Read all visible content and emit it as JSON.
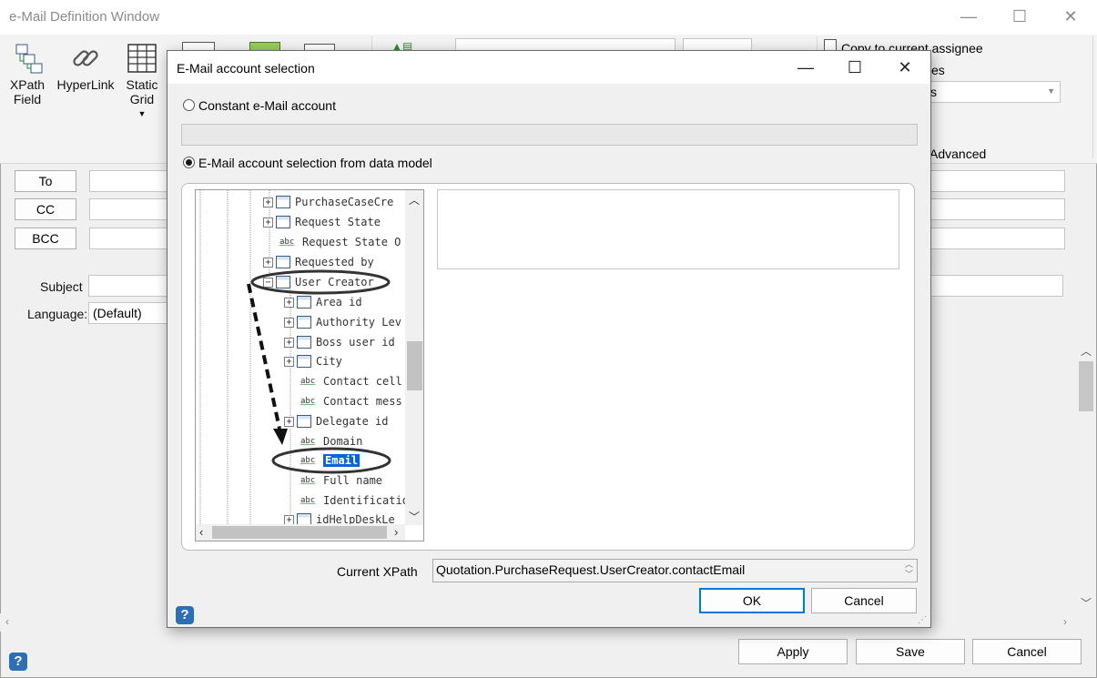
{
  "window": {
    "title": "e-Mail Definition Window",
    "minimize": "—",
    "maximize": "☐",
    "close": "✕"
  },
  "ribbon": {
    "xpath_field": "XPath\nField",
    "hyperlink": "HyperLink",
    "static_grid": "Static\nGrid",
    "copy_to_assignee": "Copy to current assignee",
    "es_fragment": "es",
    "s_fragment": "s",
    "advanced": "Advanced"
  },
  "fields": {
    "to": "To",
    "cc": "CC",
    "bcc": "BCC",
    "subject": "Subject",
    "language_label": "Language:",
    "language_value": "(Default)"
  },
  "bottom": {
    "apply": "Apply",
    "save": "Save",
    "cancel": "Cancel"
  },
  "dialog": {
    "title": "E-Mail account selection",
    "minimize": "—",
    "maximize": "☐",
    "close": "✕",
    "constant_option": "Constant e-Mail account",
    "datamodel_option": "E-Mail account selection from data model",
    "current_xpath_label": "Current XPath",
    "current_xpath_value": "Quotation.PurchaseRequest.UserCreator.contactEmail",
    "ok": "OK",
    "cancel": "Cancel"
  },
  "tree": {
    "items": [
      {
        "label": "PurchaseCaseCre",
        "type": "node"
      },
      {
        "label": "Request State",
        "type": "table"
      },
      {
        "label": "Request State O",
        "type": "abc"
      },
      {
        "label": "Requested by",
        "type": "node"
      },
      {
        "label": "User Creator",
        "type": "node-open"
      },
      {
        "label": "Area id",
        "type": "node"
      },
      {
        "label": "Authority Lev",
        "type": "table"
      },
      {
        "label": "Boss user id",
        "type": "node"
      },
      {
        "label": "City",
        "type": "table"
      },
      {
        "label": "Contact cell",
        "type": "abc"
      },
      {
        "label": "Contact mess",
        "type": "abc"
      },
      {
        "label": "Delegate id",
        "type": "node"
      },
      {
        "label": "Domain",
        "type": "abc"
      },
      {
        "label": "Email",
        "type": "abc-selected"
      },
      {
        "label": "Full name",
        "type": "abc"
      },
      {
        "label": "Identification",
        "type": "abc"
      },
      {
        "label": "idHelpDeskLe",
        "type": "table"
      }
    ]
  },
  "colors": {
    "selection": "#0a64d8",
    "annotation": "#333333",
    "help_icon": "#2d6fb4"
  }
}
